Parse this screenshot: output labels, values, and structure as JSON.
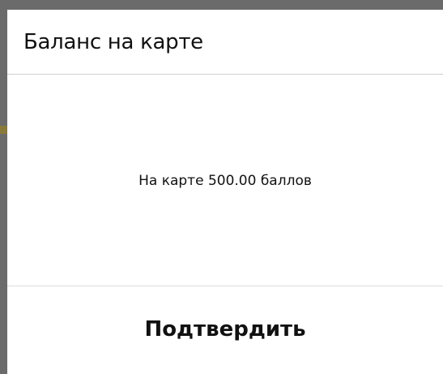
{
  "dialog": {
    "title": "Баланс на карте",
    "message": "На карте 500.00 баллов",
    "confirm_label": "Подтвердить"
  }
}
